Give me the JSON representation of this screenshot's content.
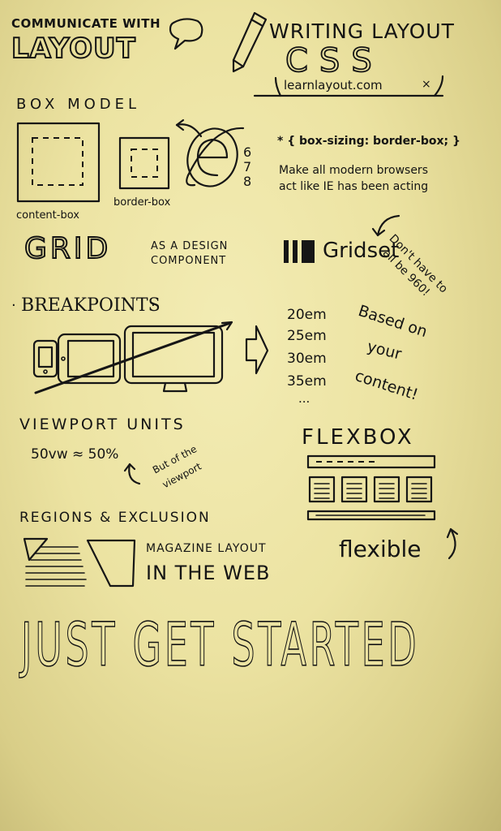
{
  "header": {
    "communicate_with": "COMMUNICATE WITH",
    "layout_logo": "LAYOUT",
    "writing_layout": "WRITING LAYOUT",
    "css": "CSS",
    "site": "learnlayout.com"
  },
  "box_model": {
    "title": "BOX MODEL",
    "content_box": "content-box",
    "border_box": "border-box",
    "ie_versions": [
      "6",
      "7",
      "8"
    ],
    "rule": "* { box-sizing: border-box; }",
    "note_line1": "Make all modern browsers",
    "note_line2": "act like IE has been acting"
  },
  "grid": {
    "title": "GRID",
    "subtitle_line1": "AS A DESIGN",
    "subtitle_line2": "COMPONENT",
    "gridset": "Gridset",
    "note_line1": "Don't have to",
    "note_line2": "all be 960!"
  },
  "breakpoints": {
    "title": "BREAKPOINTS",
    "values": [
      "20em",
      "25em",
      "30em",
      "35em",
      "..."
    ],
    "note_line1": "Based on",
    "note_line2": "your",
    "note_line3": "content!"
  },
  "viewport": {
    "title": "VIEWPORT UNITS",
    "equation": "50vw ≈ 50%",
    "note_line1": "But of the",
    "note_line2": "viewport"
  },
  "flexbox": {
    "title": "FLEXBOX",
    "flexible": "flexible"
  },
  "regions": {
    "title": "REGIONS & EXCLUSION",
    "line1": "MAGAZINE LAYOUT",
    "line2": "IN THE WEB"
  },
  "footer": {
    "slogan": "JUST GET STARTED"
  }
}
